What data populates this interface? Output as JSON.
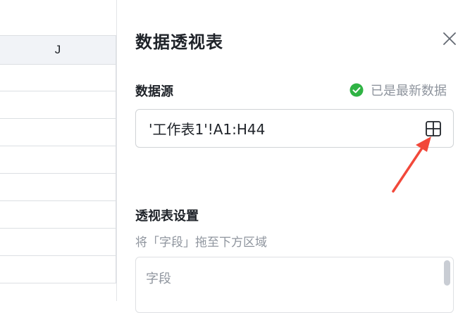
{
  "sheet": {
    "column_header": "J",
    "row_count": 8
  },
  "panel": {
    "title": "数据透视表",
    "data_source": {
      "label": "数据源",
      "status_text": "已是最新数据",
      "range_value": "'工作表1'!A1:H44"
    },
    "settings": {
      "label": "透视表设置",
      "hint": "将「字段」拖至下方区域",
      "fields_label": "字段"
    }
  },
  "colors": {
    "success": "#2fb344",
    "annotation_arrow": "#f2483a",
    "header_bg": "#f1f3f7"
  },
  "icons": [
    "close-icon",
    "check-circle-icon",
    "select-range-grid-icon"
  ]
}
